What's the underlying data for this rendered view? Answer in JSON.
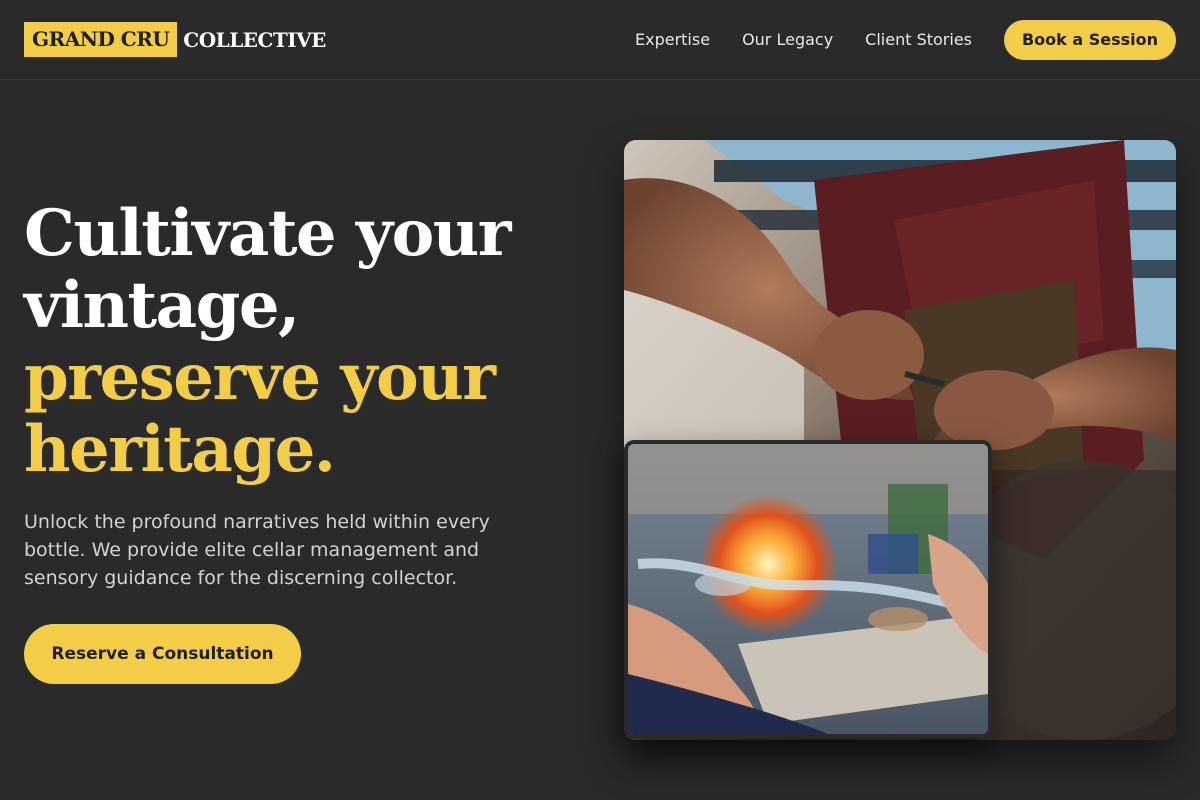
{
  "header": {
    "logo_highlight": "GRAND CRU",
    "logo_rest": "COLLECTIVE",
    "nav": [
      {
        "label": "Expertise"
      },
      {
        "label": "Our Legacy"
      },
      {
        "label": "Client Stories"
      }
    ],
    "cta_label": "Book a Session"
  },
  "hero": {
    "title_lines": [
      "Cultivate your",
      "vintage,"
    ],
    "title_accent_lines": [
      "preserve your",
      "heritage."
    ],
    "subtitle": "Unlock the profound narratives held within every bottle. We provide elite cellar management and sensory guidance for the discerning collector.",
    "cta_label": "Reserve a Consultation"
  },
  "images": {
    "main_description_icon": "craftsman-hands-photo",
    "inset_description_icon": "glassblowing-photo"
  },
  "colors": {
    "background": "#2a2a2a",
    "accent": "#f2cd45",
    "text": "#ffffff",
    "muted_text": "#d2d2d2"
  }
}
